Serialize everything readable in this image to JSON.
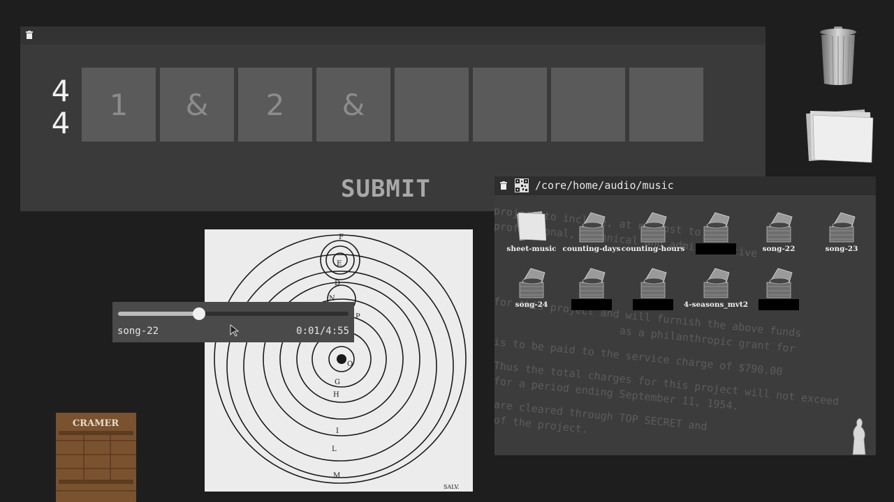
{
  "rhythm": {
    "time_signature": {
      "top": "4",
      "bottom": "4"
    },
    "beats": [
      "1",
      "&",
      "2",
      "&",
      "",
      "",
      "",
      ""
    ],
    "submit_label": "SUBMIT"
  },
  "player": {
    "track": "song-22",
    "time": "0:01/4:55",
    "progress": 0.35
  },
  "browser": {
    "path": "/core/home/audio/music",
    "files": [
      {
        "label": "sheet-music",
        "icon": "folder-icon",
        "redacted": false
      },
      {
        "label": "counting-days",
        "icon": "gramophone-icon",
        "redacted": false
      },
      {
        "label": "counting-hours",
        "icon": "gramophone-icon",
        "redacted": false
      },
      {
        "label": "",
        "icon": "gramophone-icon",
        "redacted": true
      },
      {
        "label": "song-22",
        "icon": "gramophone-icon",
        "redacted": false
      },
      {
        "label": "song-23",
        "icon": "gramophone-icon",
        "redacted": false
      },
      {
        "label": "song-24",
        "icon": "gramophone-icon",
        "redacted": false
      },
      {
        "label": "",
        "icon": "gramophone-icon",
        "redacted": true
      },
      {
        "label": "",
        "icon": "gramophone-icon",
        "redacted": true
      },
      {
        "label": "4-seasons_mvt2",
        "icon": "gramophone-icon",
        "redacted": false
      },
      {
        "label": "",
        "icon": "gramophone-icon",
        "redacted": true
      }
    ],
    "background_text": [
      "project to include, at no cost to the",
      "professional, technical and administrative",
      "for this project and will furnish the above funds",
      "as a philanthropic grant for",
      "is to be paid to the service charge of $790.00",
      "Thus the total charges for this project will not exceed",
      "for a period ending September 11, 1954.",
      "are cleared through TOP SECRET and",
      "of the project."
    ]
  },
  "solar_image": {
    "labels": [
      "F",
      "E",
      "D",
      "N",
      "P",
      "O",
      "G",
      "H",
      "I",
      "L",
      "M",
      "SALV."
    ]
  },
  "crate": {
    "brand": "CRAMER"
  }
}
